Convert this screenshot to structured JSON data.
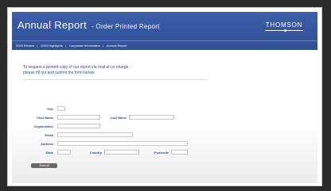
{
  "header": {
    "title": "Annual Report",
    "subtitle": "- Order Printed Report",
    "logo_text": "THOMSON"
  },
  "nav": {
    "items": [
      "2003 Review",
      "2003 Highlights",
      "Corporate Information",
      "Annual Report"
    ]
  },
  "form": {
    "intro_line1": "To request a printed copy of our report via mail at no charge,",
    "intro_line2": "please fill out and submit the form below.",
    "title_label": "Title",
    "first_name_label": "First Name",
    "last_name_label": "Last Name",
    "organization_label": "Organization",
    "email_label": "Email",
    "address_label": "Address",
    "state_label": "State",
    "country_label": "Country",
    "postcode_label": "Postcode",
    "submit_label": "Submit"
  }
}
